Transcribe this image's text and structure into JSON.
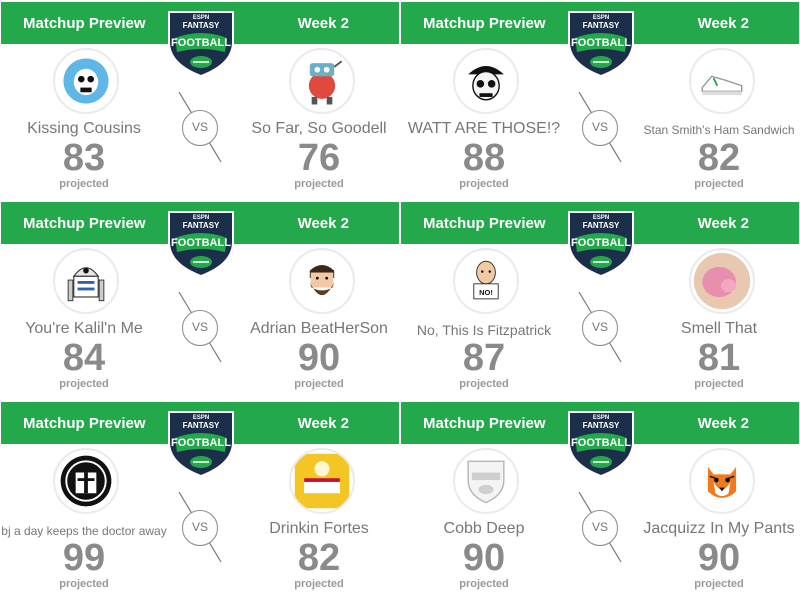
{
  "matchups": [
    {
      "header_left": "Matchup Preview",
      "header_right": "Week 2",
      "vs": "VS",
      "home": {
        "name": "Kissing Cousins",
        "score": "83",
        "label": "projected",
        "avatar": "blue-monster-skull-icon"
      },
      "away": {
        "name": "So Far, So Goodell",
        "score": "76",
        "label": "projected",
        "avatar": "red-robot-icon"
      }
    },
    {
      "header_left": "Matchup Preview",
      "header_right": "Week 2",
      "vs": "VS",
      "home": {
        "name": "WATT ARE THOSE!?",
        "score": "88",
        "label": "projected",
        "avatar": "pirate-skull-icon"
      },
      "away": {
        "name": "Stan Smith's Ham Sandwich",
        "score": "82",
        "label": "projected",
        "avatar": "white-sneaker-icon"
      }
    },
    {
      "header_left": "Matchup Preview",
      "header_right": "Week 2",
      "vs": "VS",
      "home": {
        "name": "You're Kalil'n Me",
        "score": "84",
        "label": "projected",
        "avatar": "r2d2-robot-icon"
      },
      "away": {
        "name": "Adrian BeatHerSon",
        "score": "90",
        "label": "projected",
        "avatar": "bearded-face-icon"
      }
    },
    {
      "header_left": "Matchup Preview",
      "header_right": "Week 2",
      "vs": "VS",
      "home": {
        "name": "No, This Is Fitzpatrick",
        "score": "87",
        "label": "projected",
        "avatar": "bald-man-no-sign-icon"
      },
      "away": {
        "name": "Smell That",
        "score": "81",
        "label": "projected",
        "avatar": "pink-blob-icon"
      }
    },
    {
      "header_left": "Matchup Preview",
      "header_right": "Week 2",
      "vs": "VS",
      "home": {
        "name": "bj a day keeps the doctor away",
        "score": "99",
        "label": "projected",
        "avatar": "gladiator-helmet-icon"
      },
      "away": {
        "name": "Drinkin Fortes",
        "score": "82",
        "label": "projected",
        "avatar": "beer-bottle-icon"
      }
    },
    {
      "header_left": "Matchup Preview",
      "header_right": "Week 2",
      "vs": "VS",
      "home": {
        "name": "Cobb Deep",
        "score": "90",
        "label": "projected",
        "avatar": "fantasy-football-default-icon"
      },
      "away": {
        "name": "Jacquizz In My Pants",
        "score": "90",
        "label": "projected",
        "avatar": "tiger-face-icon"
      }
    }
  ],
  "logo": {
    "brand_top": "ESPN",
    "line1": "FANTASY",
    "line2": "FOOTBALL",
    "colors": {
      "shield": "#1b2f4a",
      "green": "#23a94b",
      "white": "#ffffff"
    }
  },
  "colors": {
    "header_bg": "#23a94b",
    "text_gray": "#777777",
    "score_gray": "#8a8a8a"
  }
}
